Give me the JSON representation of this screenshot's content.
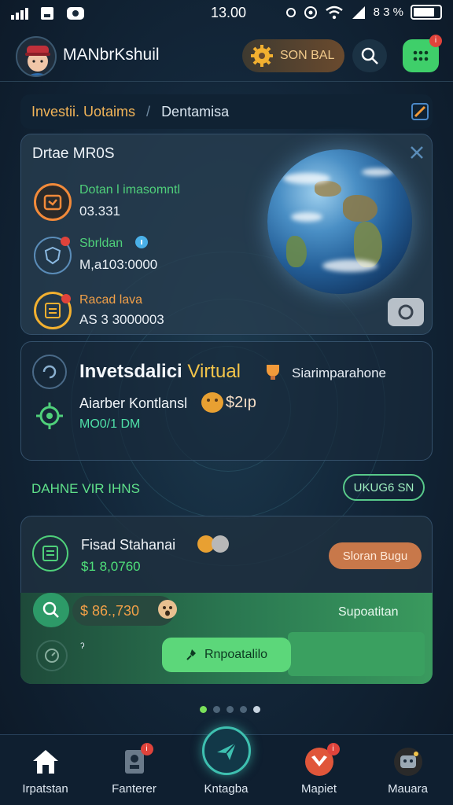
{
  "status": {
    "time": "13.00",
    "battery_text": "8 3 %"
  },
  "header": {
    "username": "MANbrKshuil",
    "coin_label": "SON BAL",
    "menu_badge": "i"
  },
  "breadcrumb": {
    "active": "Investii. Uotaims",
    "separator": "/",
    "item": "Dentamisa"
  },
  "summary_card": {
    "title": "Drtae MR0S",
    "stats": [
      {
        "label": "Dotan l imasomntl",
        "value": "03.331",
        "label_color": "#4fd07a"
      },
      {
        "label": "Sbrldan",
        "value": "M,a103:0000",
        "label_color": "#4fd07a"
      },
      {
        "label": "Racad lava",
        "value": "AS 3 3000003",
        "label_color": "#f2a048"
      }
    ]
  },
  "invest_card": {
    "title": "Invetsdalici",
    "title_highlight": "Virtual",
    "side_text": "Siarimparahone",
    "subtitle": "Aiarber Kontlansl",
    "subtitle_value": "$2ıp",
    "metric": "MO0/1 DM"
  },
  "section": {
    "label": "DAHNE VIR IHNS",
    "pill": "UKUG6 SN"
  },
  "fund_card": {
    "title": "Fisad Stahanai",
    "value": "$1 8,0760",
    "action_label": "Sloran Bugu",
    "amount": "$ 86.,730",
    "strip_label": "Supoatitan",
    "small_text": "ˀ",
    "button_label": "Rnpoatalilo"
  },
  "pager": {
    "count": 5,
    "active_index": 0
  },
  "nav": [
    {
      "label": "Irpatstan",
      "icon": "home-icon"
    },
    {
      "label": "Fanterer",
      "icon": "profile-card-icon"
    },
    {
      "label": "Kntagba",
      "icon": "plane-icon"
    },
    {
      "label": "Mapiet",
      "icon": "gift-box-icon"
    },
    {
      "label": "Mauara",
      "icon": "robot-icon"
    }
  ],
  "colors": {
    "accent_green": "#3fcf6a",
    "accent_orange": "#f2a048",
    "teal": "#3ec0b0",
    "background": "#13273a"
  }
}
